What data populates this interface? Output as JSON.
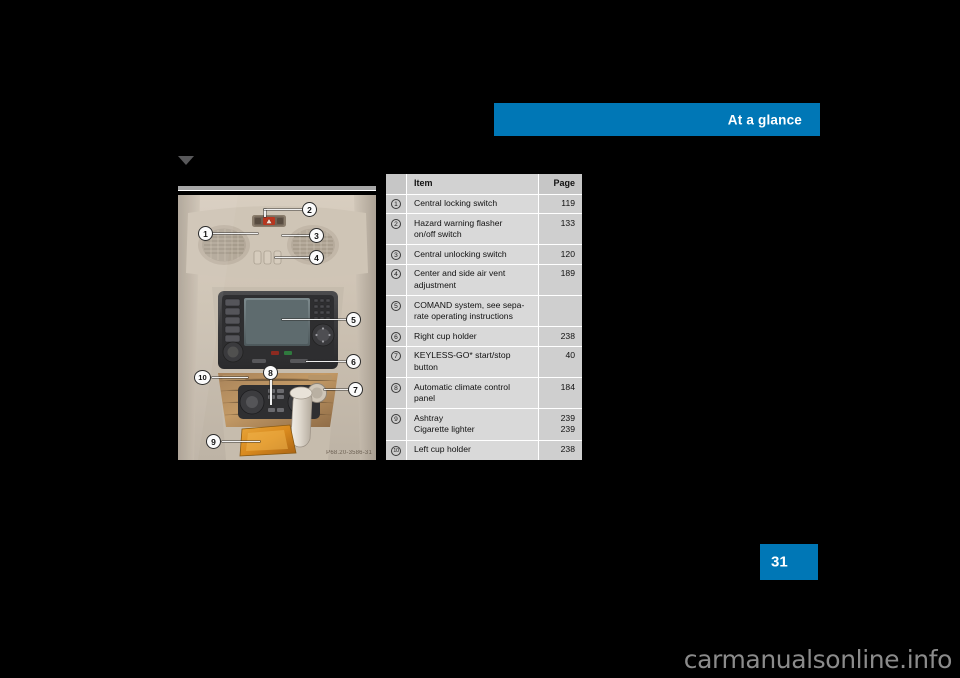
{
  "header": {
    "title": "At a glance",
    "band_color": "#0077b6"
  },
  "page_tab": {
    "number": "31",
    "color": "#0077b6"
  },
  "figure": {
    "caption": "P68.20-3586-31",
    "alt": "Center console and dashboard of vehicle interior with numbered callouts",
    "callouts": [
      {
        "n": "1"
      },
      {
        "n": "2"
      },
      {
        "n": "3"
      },
      {
        "n": "4"
      },
      {
        "n": "5"
      },
      {
        "n": "6"
      },
      {
        "n": "7"
      },
      {
        "n": "8"
      },
      {
        "n": "9"
      },
      {
        "n": "10"
      }
    ]
  },
  "table": {
    "columns": {
      "num": "",
      "item": "Item",
      "page": "Page"
    },
    "rows": [
      {
        "num": "1",
        "item": "Central locking switch",
        "item2": "",
        "page": "119",
        "page2": ""
      },
      {
        "num": "2",
        "item": "Hazard warning flasher",
        "item2": "on/off switch",
        "page": "133",
        "page2": ""
      },
      {
        "num": "3",
        "item": "Central unlocking switch",
        "item2": "",
        "page": "120",
        "page2": ""
      },
      {
        "num": "4",
        "item": "Center and side air vent",
        "item2": "adjustment",
        "page": "189",
        "page2": ""
      },
      {
        "num": "5",
        "item": "COMAND system, see sepa-",
        "item2": "rate operating instructions",
        "page": "",
        "page2": ""
      },
      {
        "num": "6",
        "item": "Right cup holder",
        "item2": "",
        "page": "238",
        "page2": ""
      },
      {
        "num": "7",
        "item": "KEYLESS-GO* start/stop",
        "item2": "button",
        "page": "40",
        "page2": ""
      },
      {
        "num": "8",
        "item": "Automatic climate control",
        "item2": "panel",
        "page": "184",
        "page2": ""
      },
      {
        "num": "9",
        "item": "Ashtray",
        "item2": "Cigarette lighter",
        "page": "239",
        "page2": "239"
      },
      {
        "num": "10",
        "item": "Left cup holder",
        "item2": "",
        "page": "238",
        "page2": ""
      }
    ]
  },
  "watermark": {
    "text": "carmanualsonline.info"
  }
}
